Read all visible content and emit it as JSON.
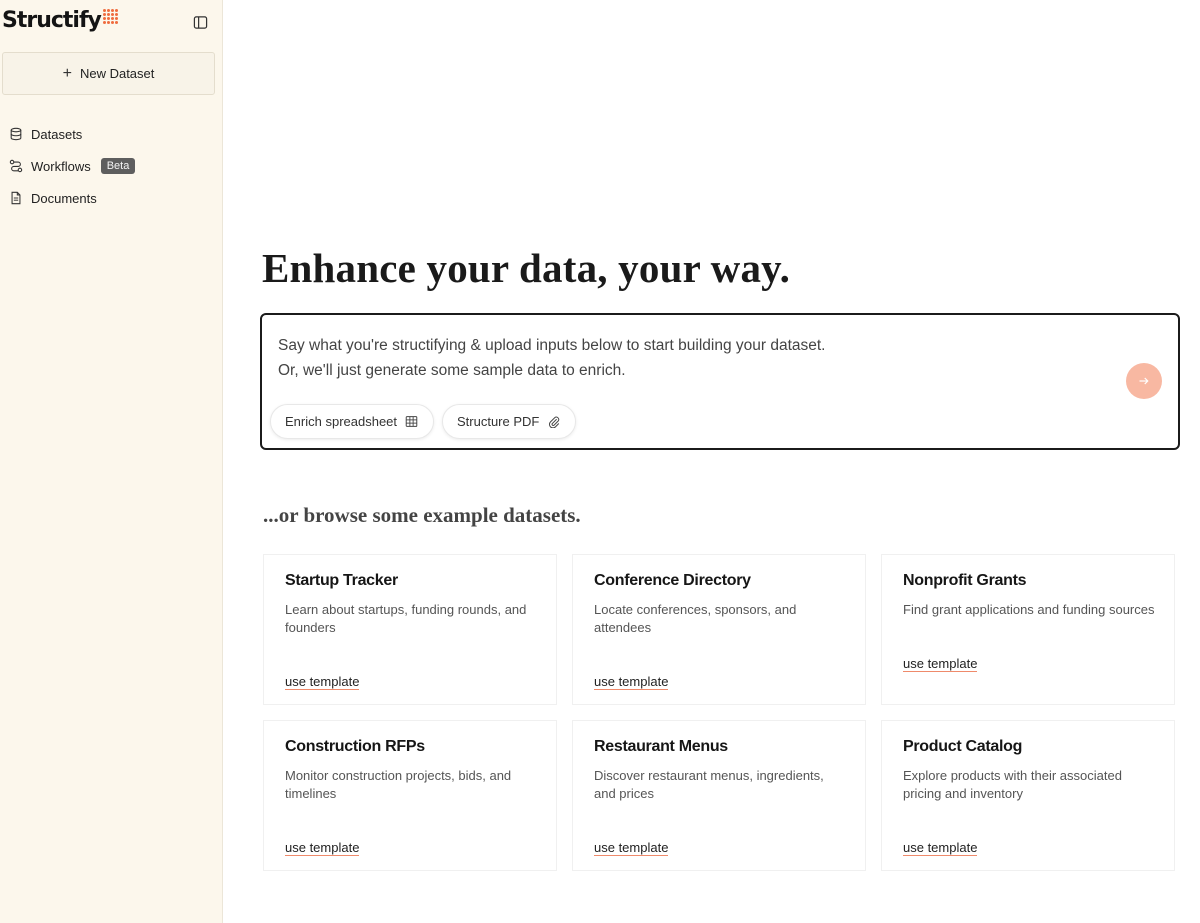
{
  "sidebar": {
    "brand": "Structify",
    "new_dataset_label": "New Dataset",
    "nav": [
      {
        "label": "Datasets",
        "icon": "database-icon"
      },
      {
        "label": "Workflows",
        "icon": "workflow-icon",
        "badge": "Beta"
      },
      {
        "label": "Documents",
        "icon": "document-icon"
      }
    ]
  },
  "main": {
    "headline": "Enhance your data, your way.",
    "prompt": {
      "line1": "Say what you're structifying & upload inputs below to start building your dataset.",
      "line2": "Or, we'll just generate some sample data to enrich.",
      "send_icon": "arrow-right-icon",
      "chips": [
        {
          "label": "Enrich spreadsheet",
          "icon": "table-icon"
        },
        {
          "label": "Structure PDF",
          "icon": "paperclip-icon"
        }
      ]
    },
    "browse_heading": "...or browse some example datasets.",
    "templates": [
      {
        "title": "Startup Tracker",
        "description": "Learn about startups, funding rounds, and founders",
        "link": "use template"
      },
      {
        "title": "Conference Directory",
        "description": "Locate conferences, sponsors, and attendees",
        "link": "use template"
      },
      {
        "title": "Nonprofit Grants",
        "description": "Find grant applications and funding sources",
        "link": "use template"
      },
      {
        "title": "Construction RFPs",
        "description": "Monitor construction projects, bids, and timelines",
        "link": "use template"
      },
      {
        "title": "Restaurant Menus",
        "description": "Discover restaurant menus, ingredients, and prices",
        "link": "use template"
      },
      {
        "title": "Product Catalog",
        "description": "Explore products with their associated pricing and inventory",
        "link": "use template"
      }
    ]
  },
  "colors": {
    "sidebar_bg": "#fcf7ec",
    "accent": "#ef6c3e",
    "send_button": "#f8b8a2"
  }
}
